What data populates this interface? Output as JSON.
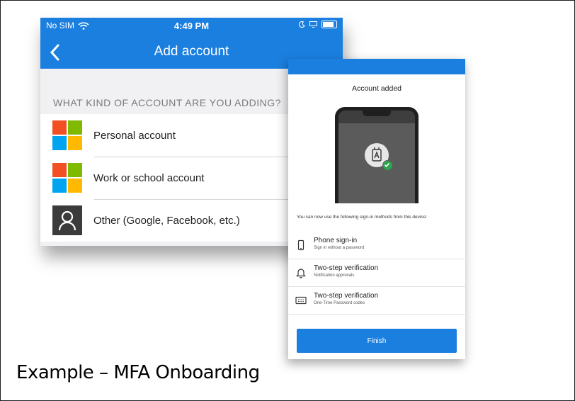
{
  "phone_left": {
    "status": {
      "carrier": "No SIM",
      "time": "4:49 PM"
    },
    "header": {
      "title": "Add account",
      "back_icon": "chevron-left-icon"
    },
    "section_label": "WHAT KIND OF ACCOUNT ARE YOU ADDING?",
    "accounts": [
      {
        "label": "Personal account",
        "icon": "microsoft-logo-icon"
      },
      {
        "label": "Work or school account",
        "icon": "microsoft-logo-icon"
      },
      {
        "label": "Other (Google, Facebook, etc.)",
        "icon": "person-icon"
      }
    ],
    "colors": {
      "header": "#1b7fe0",
      "ms_red": "#f25022",
      "ms_green": "#7fba00",
      "ms_blue": "#00a4ef",
      "ms_yellow": "#ffb900"
    }
  },
  "phone_right": {
    "title": "Account added",
    "description": "You can now use the following sign-in methods from this device:",
    "methods": [
      {
        "title": "Phone sign-in",
        "subtitle": "Sign in without a password",
        "icon": "phone-icon"
      },
      {
        "title": "Two-step verification",
        "subtitle": "Notification approvals",
        "icon": "bell-icon"
      },
      {
        "title": "Two-step verification",
        "subtitle": "One-Time Password codes",
        "icon": "keypad-icon"
      }
    ],
    "finish_label": "Finish"
  },
  "caption": "Example – MFA Onboarding"
}
